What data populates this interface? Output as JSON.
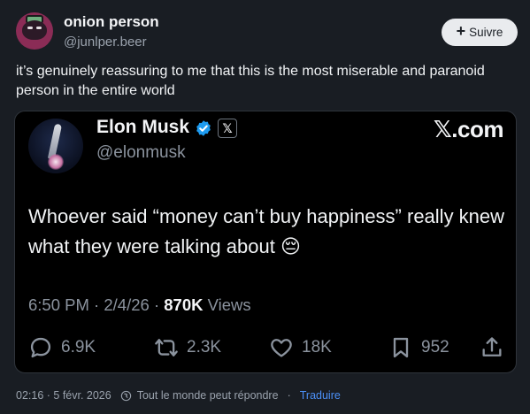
{
  "post": {
    "author_name": "onion person",
    "author_handle": "@junlper.beer",
    "follow_label": "Suivre",
    "text": "it’s genuinely reassuring to me that this is the most miserable and paranoid person in the entire world"
  },
  "quoted": {
    "name": "Elon Musk",
    "handle": "@elonmusk",
    "badge_label": "𝕏",
    "brand": "𝕏.com",
    "text": "Whoever said “money can’t buy happiness” really knew what they were talking about 😔",
    "time": "6:50 PM",
    "date": "2/4/26",
    "views_count": "870K",
    "views_label": "Views",
    "replies": "6.9K",
    "reposts": "2.3K",
    "likes": "18K",
    "bookmarks": "952"
  },
  "footer": {
    "timestamp": "02:16 · 5 févr. 2026",
    "reply_setting": "Tout le monde peut répondre",
    "separator": "·",
    "translate_label": "Traduire"
  },
  "colors": {
    "background": "#191d23",
    "card": "#000000",
    "verified": "#1d9bf0",
    "link": "#4b8ff6"
  }
}
